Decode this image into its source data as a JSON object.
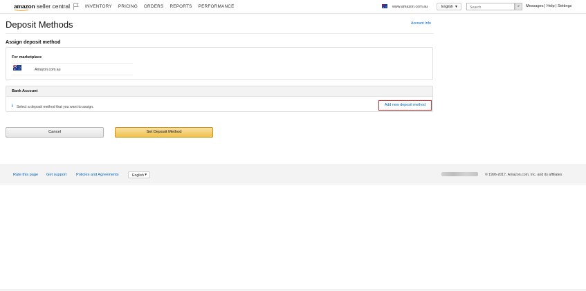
{
  "header": {
    "logo_brand": "amazon",
    "logo_product": "seller central",
    "nav": [
      "INVENTORY",
      "PRICING",
      "ORDERS",
      "REPORTS",
      "PERFORMANCE"
    ],
    "marketplace_url": "www.amazon.com.au",
    "language": "English",
    "search_placeholder": "Search",
    "links": {
      "messages": "Messages",
      "sep1": " | ",
      "help": "Help",
      "sep2": " | ",
      "settings": "Settings"
    }
  },
  "page": {
    "title": "Deposit Methods",
    "account_info": "Account Info",
    "section_title": "Assign deposit method",
    "marketplace_label": "For marketplace",
    "marketplace_name": "Amazon.com.au",
    "bank_header": "Bank Account",
    "info_text": "Select a deposit method that you want to assign.",
    "add_method": "Add new deposit method",
    "cancel": "Cancel",
    "set_method": "Set Deposit Method"
  },
  "footer": {
    "rate": "Rate this page",
    "support": "Get support",
    "policies": "Policies and Agreements",
    "language": "English",
    "copyright": "© 1996-2017, Amazon.com, Inc. and its affiliates"
  },
  "colors": {
    "link": "#0066c0",
    "highlight": "#d32a2a",
    "primary_button": "#f0c14b"
  },
  "icons": {
    "flag": "flag-outline-icon",
    "search": "search-icon",
    "info": "info-icon",
    "caret": "caret-down-icon"
  }
}
